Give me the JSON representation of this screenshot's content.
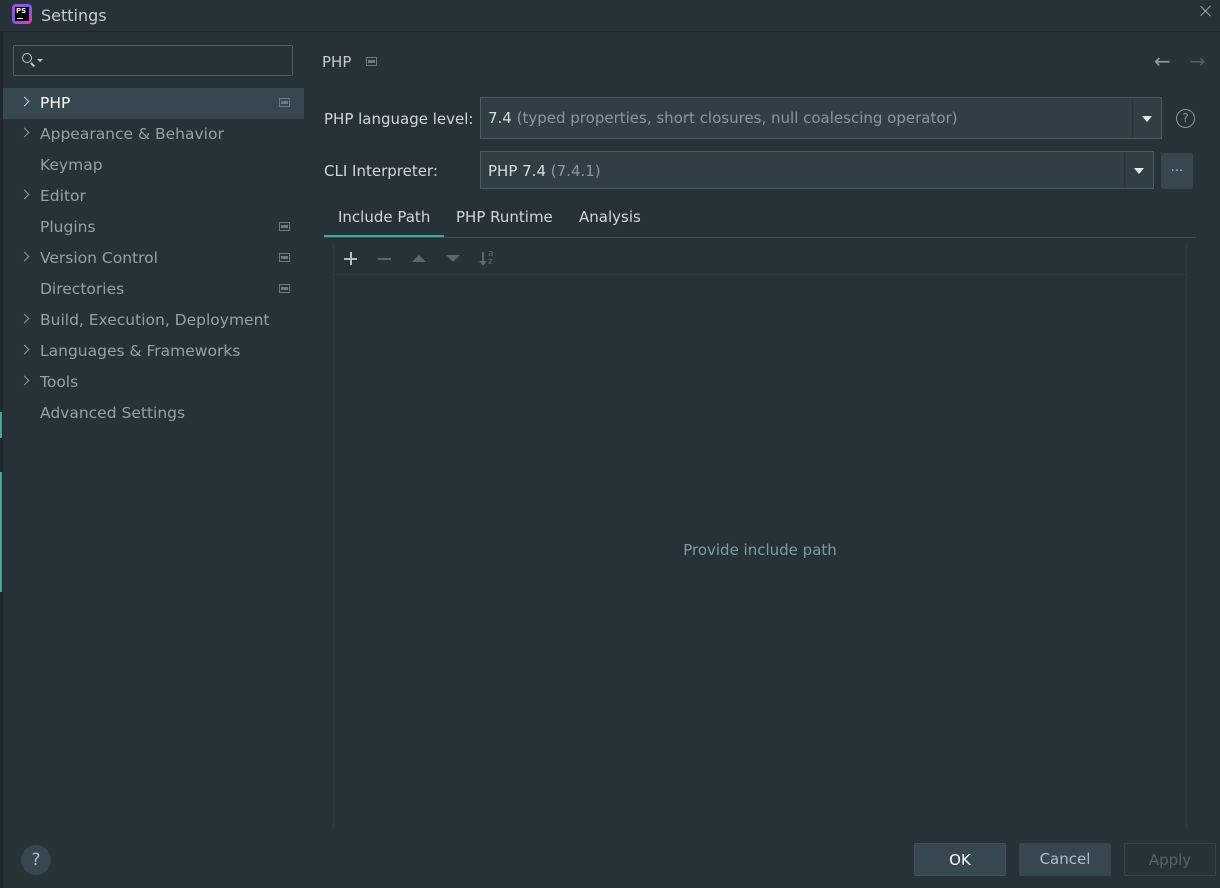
{
  "window": {
    "title": "Settings",
    "icon": "phpstorm-logo",
    "icon_text": "PS"
  },
  "search": {
    "value": "",
    "placeholder": ""
  },
  "sidebar": {
    "items": [
      {
        "label": "PHP",
        "expandable": true,
        "selected": true,
        "project_icon": true
      },
      {
        "label": "Appearance & Behavior",
        "expandable": true,
        "selected": false,
        "project_icon": false
      },
      {
        "label": "Keymap",
        "expandable": false,
        "selected": false,
        "project_icon": false
      },
      {
        "label": "Editor",
        "expandable": true,
        "selected": false,
        "project_icon": false
      },
      {
        "label": "Plugins",
        "expandable": false,
        "selected": false,
        "project_icon": true
      },
      {
        "label": "Version Control",
        "expandable": true,
        "selected": false,
        "project_icon": true
      },
      {
        "label": "Directories",
        "expandable": false,
        "selected": false,
        "project_icon": true
      },
      {
        "label": "Build, Execution, Deployment",
        "expandable": true,
        "selected": false,
        "project_icon": false
      },
      {
        "label": "Languages & Frameworks",
        "expandable": true,
        "selected": false,
        "project_icon": false
      },
      {
        "label": "Tools",
        "expandable": true,
        "selected": false,
        "project_icon": false
      },
      {
        "label": "Advanced Settings",
        "expandable": false,
        "selected": false,
        "project_icon": false
      }
    ]
  },
  "help_button": {
    "label": "?"
  },
  "main": {
    "breadcrumb": "PHP",
    "nav": {
      "back": "←",
      "forward": "→"
    },
    "language_level": {
      "label": "PHP language level:",
      "value": "7.4",
      "detail": "(typed properties, short closures, null coalescing operator)"
    },
    "cli_interpreter": {
      "label": "CLI Interpreter:",
      "value": "PHP 7.4",
      "detail": "(7.4.1)",
      "more": "..."
    },
    "help_icon": "?",
    "tabs": [
      {
        "label": "Include Path",
        "active": true
      },
      {
        "label": "PHP Runtime",
        "active": false
      },
      {
        "label": "Analysis",
        "active": false
      }
    ],
    "toolbar": {
      "icons": [
        "plus-icon",
        "minus-icon",
        "move-up-icon",
        "move-down-icon",
        "sort-alpha-icon"
      ],
      "sort_a": "a",
      "sort_z": "z"
    },
    "empty_text": "Provide include path"
  },
  "footer": {
    "ok": "OK",
    "cancel": "Cancel",
    "apply": "Apply"
  },
  "colors": {
    "background": "#263238",
    "selection": "#37474f",
    "accent": "#3ea99f",
    "text": "#b0bec5"
  }
}
